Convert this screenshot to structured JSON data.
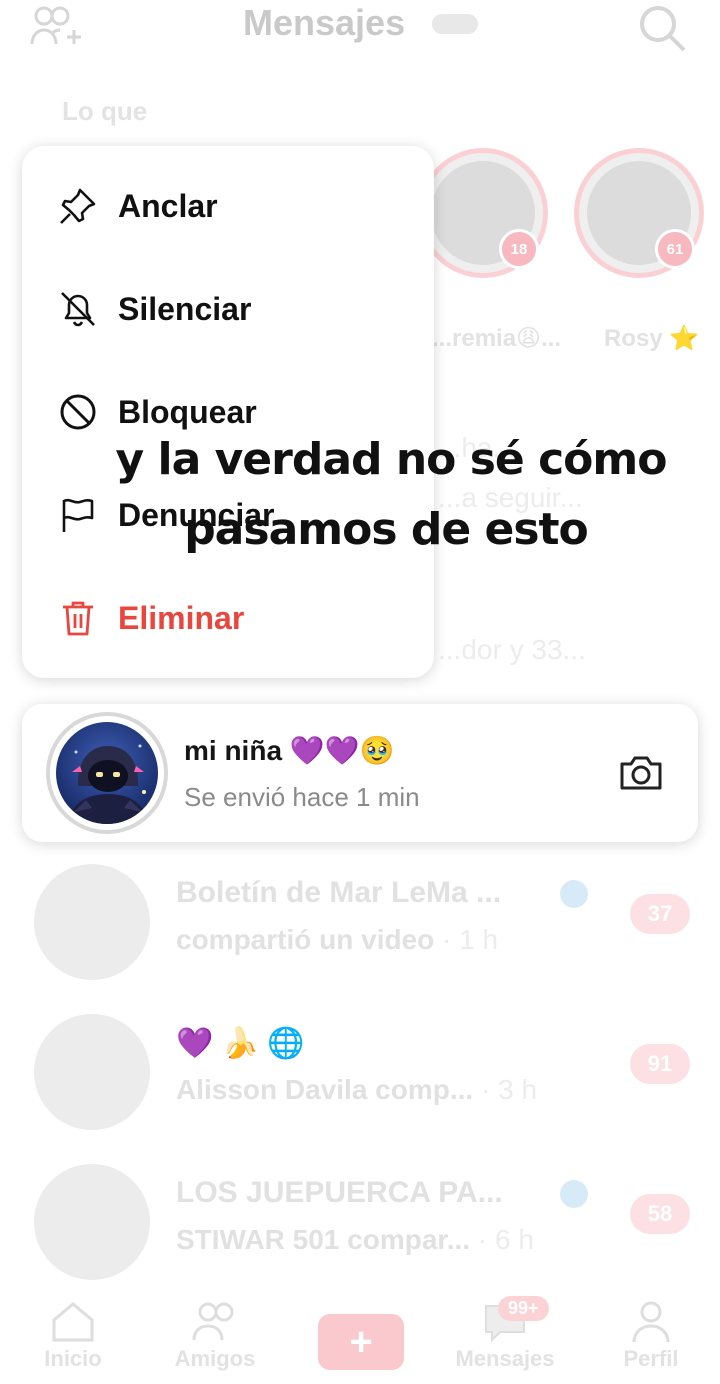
{
  "header": {
    "title": "Mensajes",
    "add_friends_icon": "add-friends-icon",
    "search_icon": "search-icon"
  },
  "stories": {
    "label": "Lo que",
    "items": [
      {
        "name": "...remia😩...",
        "badge": "18"
      },
      {
        "name": "Rosy ⭐",
        "badge": "61"
      }
    ]
  },
  "background_fragments": {
    "line1": "...ha...",
    "line2": "...a seguir...",
    "line3": "...dor y 33..."
  },
  "context_menu": {
    "items": [
      {
        "label": "Anclar",
        "icon": "pin-icon"
      },
      {
        "label": "Silenciar",
        "icon": "bell-off-icon"
      },
      {
        "label": "Bloquear",
        "icon": "block-icon"
      },
      {
        "label": "Denunciar",
        "icon": "flag-icon"
      },
      {
        "label": "Eliminar",
        "icon": "trash-icon",
        "color": "#e9463e"
      }
    ]
  },
  "selected_chat": {
    "name": "mi niña 💜💜🥹",
    "status": "Se envió hace 1 min",
    "camera_icon": "camera-icon"
  },
  "chats": [
    {
      "name": "Boletín de Mar LeMa ...",
      "preview": "compartió un video",
      "time": "· 1 h",
      "unread": "37"
    },
    {
      "name": "💜 🍌 🌐",
      "preview": "Alisson Davila comp...",
      "time": "· 3 h",
      "unread": "91"
    },
    {
      "name": "LOS JUEPUERCA PA...",
      "preview": "STIWAR 501 compar...",
      "time": "· 6 h",
      "unread": "58"
    }
  ],
  "bottom_nav": {
    "items": [
      {
        "label": "Inicio",
        "icon": "home-icon"
      },
      {
        "label": "Amigos",
        "icon": "friends-icon"
      },
      {
        "label": "Mensajes",
        "icon": "inbox-icon",
        "badge": "99+"
      },
      {
        "label": "Perfil",
        "icon": "profile-icon"
      }
    ],
    "create_label": "+"
  },
  "caption": {
    "line1": "y la verdad no sé cómo",
    "line2": "pasamos de esto"
  },
  "colors": {
    "accent": "#fe2c55",
    "danger": "#e9463e"
  }
}
